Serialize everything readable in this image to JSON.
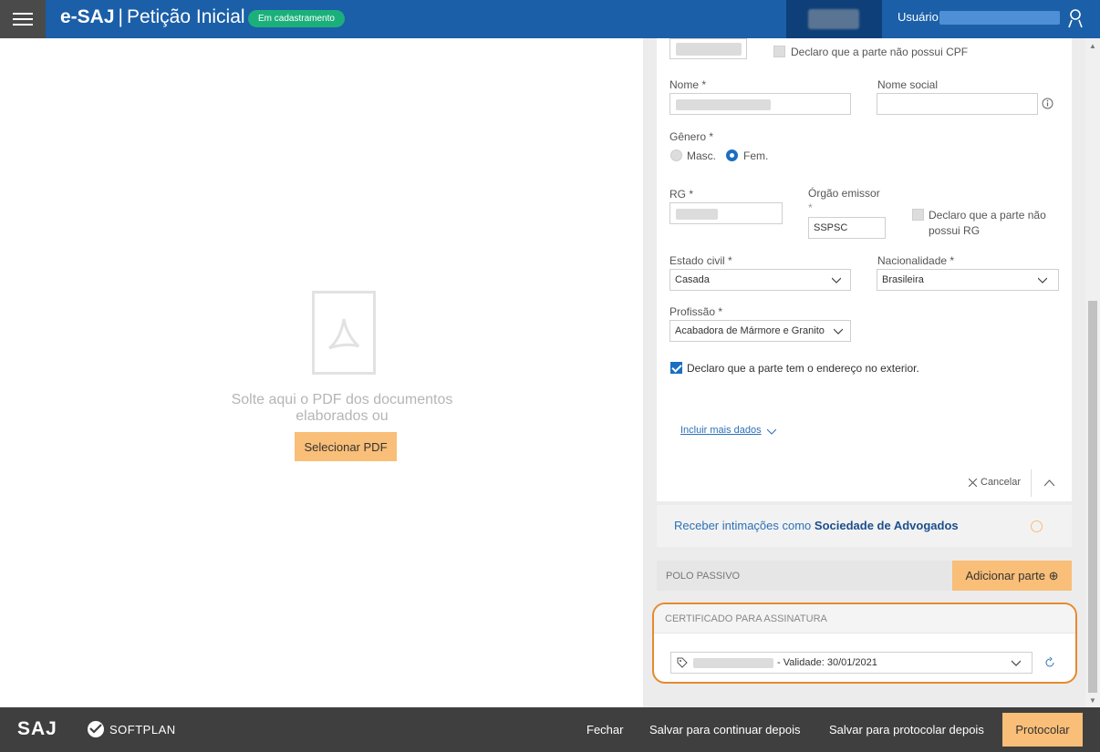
{
  "header": {
    "brand_bold": "e-SAJ",
    "brand_sep": "|",
    "brand_title": "Petição Inicial",
    "status": "Em cadastramento",
    "user_label": "Usuário",
    "colors": {
      "header_bg": "#1b5fa8",
      "status_pill": "#1bb07b",
      "accent_button": "#f9be78"
    }
  },
  "dropzone": {
    "text": "Solte aqui o PDF dos documentos elaborados ou",
    "button": "Selecionar PDF"
  },
  "form": {
    "cpf_checkbox": "Declaro que a parte não possui CPF",
    "nome_label": "Nome *",
    "nome_social_label": "Nome social",
    "genero_label": "Gênero *",
    "genero_options": [
      {
        "label": "Masc.",
        "selected": false
      },
      {
        "label": "Fem.",
        "selected": true
      }
    ],
    "rg_label": "RG *",
    "orgao_label": "Órgão emissor",
    "orgao_required": "*",
    "orgao_value": "SSPSC",
    "rg_checkbox_line1": "Declaro que a parte não",
    "rg_checkbox_line2": "possui RG",
    "estado_civil_label": "Estado civil *",
    "estado_civil_value": "Casada",
    "nacionalidade_label": "Nacionalidade *",
    "nacionalidade_value": "Brasileira",
    "profissao_label": "Profissão *",
    "profissao_value": "Acabadora de Mármore e Granito",
    "exterior_checkbox": "Declaro que a parte tem o endereço no exterior.",
    "exterior_checked": true,
    "incluir_link": "Incluir mais dados",
    "cancel_label": "Cancelar"
  },
  "intimacoes": {
    "prefix": "Receber intimações como ",
    "bold": "Sociedade de Advogados"
  },
  "polo_passivo": {
    "label": "POLO PASSIVO",
    "add_button": "Adicionar parte"
  },
  "certificado": {
    "label": "CERTIFICADO PARA ASSINATURA",
    "validity": "- Validade: 30/01/2021"
  },
  "footer": {
    "saj": "SAJ",
    "softplan": "SOFTPLAN",
    "fechar": "Fechar",
    "salvar_continuar": "Salvar para continuar depois",
    "salvar_protocolar": "Salvar para protocolar depois",
    "protocolar": "Protocolar"
  }
}
